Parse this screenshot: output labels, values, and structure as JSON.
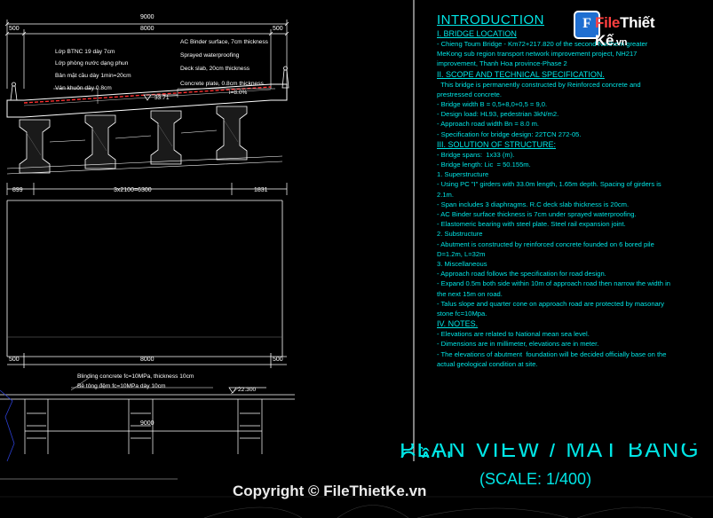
{
  "drawing": {
    "top_dims": [
      "9000",
      "8000",
      "500",
      "500"
    ],
    "layer_labels_left": [
      "Lớp BTNC 19 dày 7cm",
      "Lớp phòng nước dạng phun",
      "Bản mặt cầu dày 1min=20cm",
      "Ván khuôn dày 0.8cm"
    ],
    "layer_labels_right": [
      "AC Binder surface, 7cm thickness",
      "Sprayed waterproofing",
      "Deck slab, 20cm thickness",
      "Concrete plate, 0.8cm thickness"
    ],
    "slope": "i=8.0%",
    "elev_top": "33.71",
    "bottom_dims": [
      "899",
      "3x2100=6300",
      "1831"
    ],
    "lower_dims": [
      "500",
      "8000",
      "500"
    ],
    "blinding_en": "Blinding concrete fc=10MPa, thickness 10cm",
    "blinding_vn": "Bê tông đệm fc=10MPa dày 10cm",
    "elev_bottom": "22.300",
    "pile_dim": "9000"
  },
  "notes": {
    "title": "INTRODUCTION",
    "s1_title": "I. BRIDGE LOCATION",
    "s1_text": "- Chieng Toum Bridge - Km72+217.820 of the second Northern greater\nMeKong sub region transport network improvement project, NH217\nimprovement, Thanh Hoa province-Phase 2",
    "s2_title": "II. SCOPE AND TECHNICAL SPECIFICATION.",
    "s2_text": "  This bridge is permanently constructed by Reinforced concrete and\nprestressed concrete.\n- Bridge width B = 0,5+8,0+0,5 = 9,0.\n- Design load: HL93, pedestrian 3kN/m2.\n- Approach road width Bn = 8.0 m.\n- Specification for bridge design: 22TCN 272-05.",
    "s3_title": "III. SOLUTION OF STRUCTURE:",
    "s3_text": "- Bridge spans:  1x33 (m).\n- Bridge length: Lic  = 50.155m.\n1. Superstructure\n- Using PC \"I\" girders with 33.0m length, 1.65m depth. Spacing of girders is\n2.1m.\n- Span includes 3 diaphragms. R.C deck slab thickness is 20cm.\n- AC Binder surface thickness is 7cm under sprayed waterproofing.\n- Elastomeric bearing with steel plate. Steel rail expansion joint.\n2. Substructure\n- Abutment is constructed by reinforced concrete founded on 6 bored pile\nD=1.2m, L=32m\n3. Miscellaneous\n- Approach road follows the specification for road design.\n- Expand 0.5m both side within 10m of approach road then narrow the width in\nthe next 15m on road.\n- Talus slope and quarter cone on approach road are protected by masonary\nstone fc=10Mpa.",
    "s4_title": "IV. NOTES.",
    "s4_text": "- Elevations are related to National mean sea level.\n- Dimensions are in millimeter, elevations are in meter.\n- The elevations of abutment  foundation will be decided officially base on the\nactual geological condition at site."
  },
  "plan_title": "PLAN VIEW / MẶT BẰNG CẦU",
  "scale": "(SCALE: 1/400)",
  "watermark": {
    "mark": "F",
    "prefix": "File",
    "name": "Thiết Kế",
    "suffix": ".vn"
  },
  "copyright": "Copyright © FileThietKe.vn",
  "colors": {
    "cyan": "#00e5e5",
    "red": "#ff3030",
    "line": "#ffffff",
    "grey": "#8a8a8a",
    "blue": "#2b3fd0"
  }
}
